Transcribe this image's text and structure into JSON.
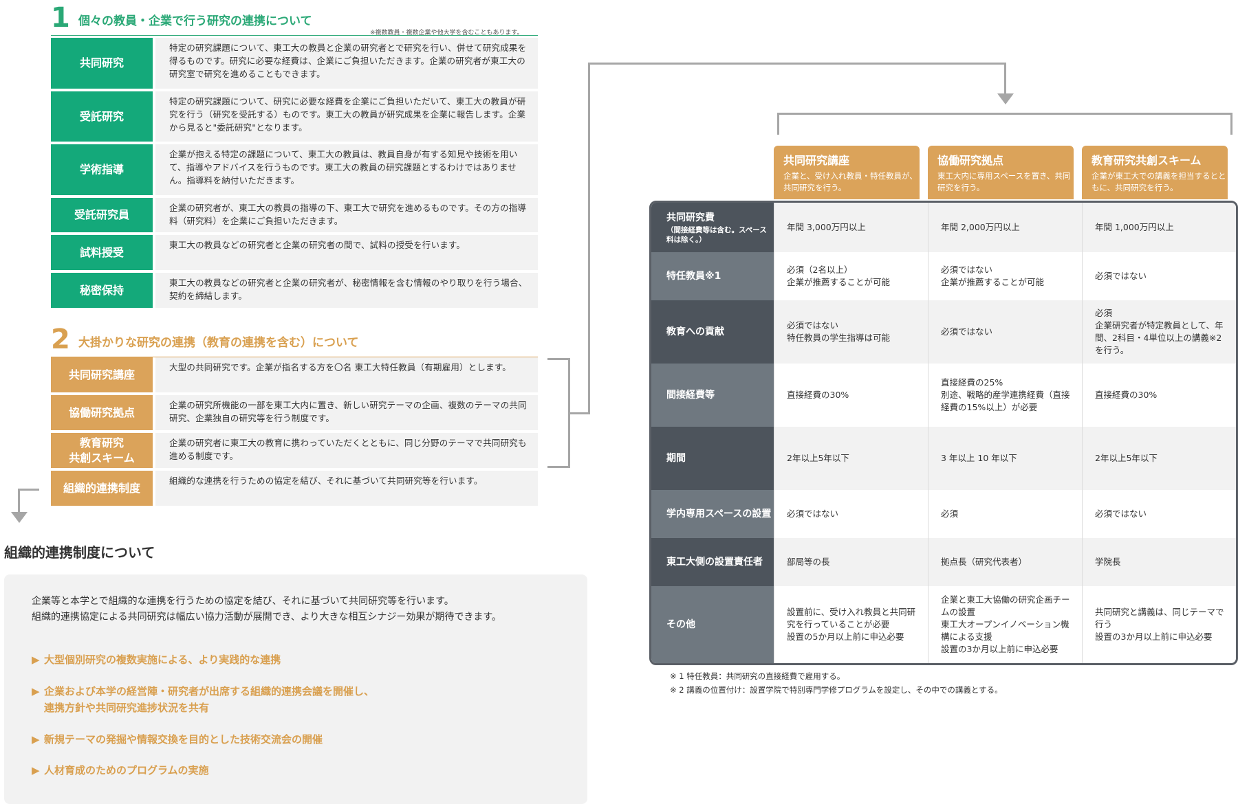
{
  "section1": {
    "number": "1",
    "title": "個々の教員・企業で行う研究の連携について",
    "note": "※複数教員・複数企業や他大学を含むこともあります。",
    "rows": [
      {
        "label": "共同研究",
        "text": "特定の研究課題について、東工大の教員と企業の研究者とで研究を行い、併せて研究成果を得るものです。研究に必要な経費は、企業にご負担いただきます。企業の研究者が東工大の研究室で研究を進めることもできます。"
      },
      {
        "label": "受託研究",
        "text": "特定の研究課題について、研究に必要な経費を企業にご負担いただいて、東工大の教員が研究を行う（研究を受託する）ものです。東工大の教員が研究成果を企業に報告します。企業から見ると\"委託研究\"となります。"
      },
      {
        "label": "学術指導",
        "text": "企業が抱える特定の課題について、東工大の教員は、教員自身が有する知見や技術を用いて、指導やアドバイスを行うものです。東工大の教員の研究課題とするわけではありません。指導料を納付いただきます。"
      },
      {
        "label": "受託研究員",
        "text": "企業の研究者が、東工大の教員の指導の下、東工大で研究を進めるものです。その方の指導料（研究料）を企業にご負担いただきます。"
      },
      {
        "label": "試料授受",
        "text": "東工大の教員などの研究者と企業の研究者の間で、試料の授受を行います。"
      },
      {
        "label": "秘密保持",
        "text": "東工大の教員などの研究者と企業の研究者が、秘密情報を含む情報のやり取りを行う場合、契約を締結します。"
      }
    ]
  },
  "section2": {
    "number": "2",
    "title": "大掛かりな研究の連携（教育の連携を含む）について",
    "rows": [
      {
        "label": "共同研究講座",
        "text": "大型の共同研究です。企業が指名する方を〇名 東工大特任教員（有期雇用）とします。"
      },
      {
        "label": "協働研究拠点",
        "text": "企業の研究所機能の一部を東工大内に置き、新しい研究テーマの企画、複数のテーマの共同研究、企業独自の研究等を行う制度です。"
      },
      {
        "label_line1": "教育研究",
        "label_line2": "共創スキーム",
        "text": "企業の研究者に東工大の教育に携わっていただくとともに、同じ分野のテーマで共同研究も進める制度です。"
      },
      {
        "label": "組織的連携制度",
        "text": "組織的な連携を行うための協定を結び、それに基づいて共同研究等を行います。"
      }
    ]
  },
  "org": {
    "title": "組織的連携制度について",
    "desc_line1": "企業等と本学とで組織的な連携を行うための協定を結び、それに基づいて共同研究等を行います。",
    "desc_line2": "組織的連携協定による共同研究は幅広い協力活動が展開でき、より大きな相互シナジー効果が期待できます。",
    "bullets": [
      {
        "line1": "大型個別研究の複数実施による、より実践的な連携"
      },
      {
        "line1": "企業および本学の経営陣・研究者が出席する組織的連携会議を開催し、",
        "line2": "連携方針や共同研究進捗状況を共有"
      },
      {
        "line1": "新規テーマの発掘や情報交換を目的とした技術交流会の開催"
      },
      {
        "line1": "人材育成のためのプログラムの実施"
      }
    ]
  },
  "table": {
    "columns": [
      {
        "title": "共同研究講座",
        "sub": "企業と、受け入れ教員・特任教員が、共同研究を行う。"
      },
      {
        "title": "協働研究拠点",
        "sub": "東工大内に専用スペースを置き、共同研究を行う。"
      },
      {
        "title": "教育研究共創スキーム",
        "sub": "企業が東工大での講義を担当するとともに、共同研究を行う。"
      }
    ],
    "rows": [
      {
        "head": "共同研究費",
        "head_sub": "（間接経費等は含む。スペース料は除く。）",
        "cells": [
          "年間 3,000万円以上",
          "年間 2,000万円以上",
          "年間 1,000万円以上"
        ]
      },
      {
        "head": "特任教員※1",
        "cells": [
          "必須（2名以上）\n企業が推薦することが可能",
          "必須ではない\n企業が推薦することが可能",
          "必須ではない"
        ]
      },
      {
        "head": "教育への貢献",
        "cells": [
          "必須ではない\n特任教員の学生指導は可能",
          "必須ではない",
          "必須\n企業研究者が特定教員として、年間、2科目・4単位以上の講義※2を行う。"
        ]
      },
      {
        "head": "間接経費等",
        "cells": [
          "直接経費の30%",
          "直接経費の25%\n別途、戦略的産学連携経費（直接経費の15%以上）が必要",
          "直接経費の30%"
        ]
      },
      {
        "head": "期間",
        "cells": [
          "2年以上5年以下",
          "3 年以上 10 年以下",
          "2年以上5年以下"
        ]
      },
      {
        "head": "学内専用スペースの設置",
        "cells": [
          "必須ではない",
          "必須",
          "必須ではない"
        ]
      },
      {
        "head": "東工大側の設置責任者",
        "cells": [
          "部局等の長",
          "拠点長（研究代表者）",
          "学院長"
        ]
      },
      {
        "head": "その他",
        "cells": [
          "設置前に、受け入れ教員と共同研究を行っていることが必要\n設置の5か月以上前に申込必要",
          "企業と東工大協働の研究企画チームの設置\n東工大オープンイノベーション機構による支援\n設置の3か月以上前に申込必要",
          "共同研究と講義は、同じテーマで行う\n設置の3か月以上前に申込必要"
        ]
      }
    ],
    "footnote1": "※ 1 特任教員：共同研究の直接経費で雇用する。",
    "footnote2": "※ 2 講義の位置付け：設置学院で特別専門学修プログラムを設定し、その中での講義とする。"
  },
  "colors": {
    "green": "#14a97a",
    "orange": "#dba35a",
    "dark_header": "#4d545c",
    "light_header": "#6f7880",
    "connector": "#a6a6a6"
  }
}
